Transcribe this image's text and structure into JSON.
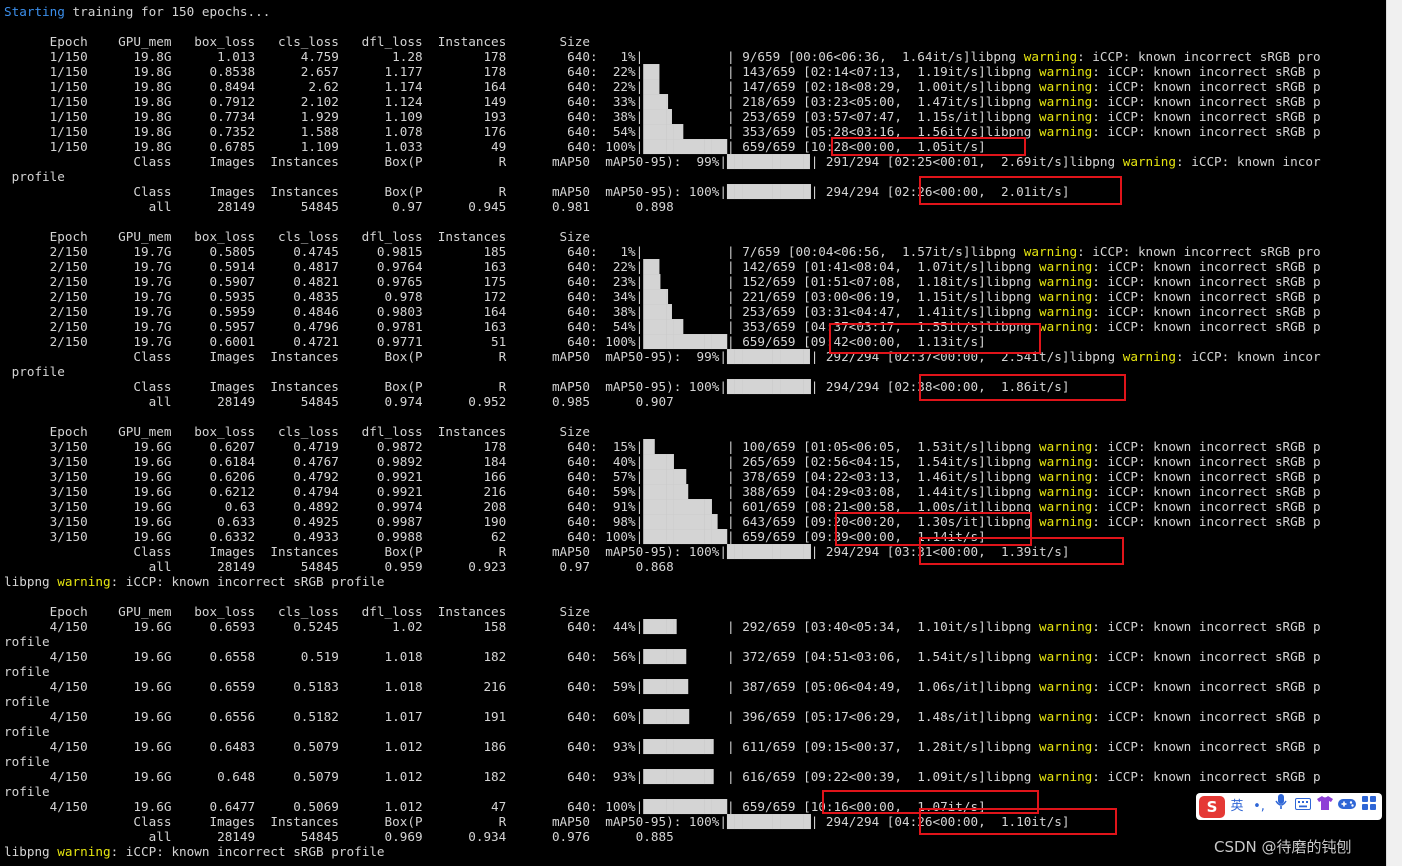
{
  "colors": {
    "background": "#000000",
    "text": "#d4d4d4",
    "info_blue": "#3b8eea",
    "warning_yellow": "#e5e510",
    "highlight_red": "#e0141a"
  },
  "lines": [
    [
      [
        "Starting",
        "b"
      ],
      [
        " training for 150 epochs...",
        "w"
      ]
    ],
    [],
    [
      [
        "      Epoch    GPU_mem   box_loss   cls_loss   dfl_loss  Instances       Size",
        "w"
      ]
    ],
    [
      [
        "      1/150      19.8G      1.013      4.759       1.28        178        640:   1%|           | 9/659 [00:06<06:36,  1.64it/s]libpng ",
        "w"
      ],
      [
        "warning",
        "y"
      ],
      [
        ": iCCP: known incorrect sRGB pro",
        "w"
      ]
    ],
    [
      [
        "      1/150      19.8G     0.8538      2.657      1.177        178        640:  22%|██▏        | 143/659 [02:14<07:13,  1.19it/s]libpng ",
        "w"
      ],
      [
        "warning",
        "y"
      ],
      [
        ": iCCP: known incorrect sRGB p",
        "w"
      ]
    ],
    [
      [
        "      1/150      19.8G     0.8494       2.62      1.174        164        640:  22%|██▏        | 147/659 [02:18<08:29,  1.00it/s]libpng ",
        "w"
      ],
      [
        "warning",
        "y"
      ],
      [
        ": iCCP: known incorrect sRGB p",
        "w"
      ]
    ],
    [
      [
        "      1/150      19.8G     0.7912      2.102      1.124        149        640:  33%|███▎       | 218/659 [03:23<05:00,  1.47it/s]libpng ",
        "w"
      ],
      [
        "warning",
        "y"
      ],
      [
        ": iCCP: known incorrect sRGB p",
        "w"
      ]
    ],
    [
      [
        "      1/150      19.8G     0.7734      1.929      1.109        193        640:  38%|███▊       | 253/659 [03:57<07:47,  1.15s/it]libpng ",
        "w"
      ],
      [
        "warning",
        "y"
      ],
      [
        ": iCCP: known incorrect sRGB p",
        "w"
      ]
    ],
    [
      [
        "      1/150      19.8G     0.7352      1.588      1.078        176        640:  54%|█████▎     | 353/659 [05:28<03:16,  1.56it/s]libpng ",
        "w"
      ],
      [
        "warning",
        "y"
      ],
      [
        ": iCCP: known incorrect sRGB p",
        "w"
      ]
    ],
    [
      [
        "      1/150      19.8G     0.6785      1.109      1.033         49        640: 100%|███████████| 659/659 [10:28<00:00,  1.05it/s]",
        "w"
      ]
    ],
    [
      [
        "                 Class     Images  Instances      Box(P          R      mAP50  mAP50-95):  99%|██████████▉| 291/294 [02:25<00:01,  2.69it/s]libpng ",
        "w"
      ],
      [
        "warning",
        "y"
      ],
      [
        ": iCCP: known incor",
        "w"
      ]
    ],
    [
      [
        " profile",
        "w"
      ]
    ],
    [
      [
        "                 Class     Images  Instances      Box(P          R      mAP50  mAP50-95): 100%|███████████| 294/294 [02:26<00:00,  2.01it/s]",
        "w"
      ]
    ],
    [
      [
        "                   all      28149      54845       0.97      0.945      0.981      0.898",
        "w"
      ]
    ],
    [],
    [
      [
        "      Epoch    GPU_mem   box_loss   cls_loss   dfl_loss  Instances       Size",
        "w"
      ]
    ],
    [
      [
        "      2/150      19.7G     0.5805     0.4745     0.9815        185        640:   1%|           | 7/659 [00:04<06:56,  1.57it/s]libpng ",
        "w"
      ],
      [
        "warning",
        "y"
      ],
      [
        ": iCCP: known incorrect sRGB pro",
        "w"
      ]
    ],
    [
      [
        "      2/150      19.7G     0.5914     0.4817     0.9764        163        640:  22%|██▏        | 142/659 [01:41<08:04,  1.07it/s]libpng ",
        "w"
      ],
      [
        "warning",
        "y"
      ],
      [
        ": iCCP: known incorrect sRGB p",
        "w"
      ]
    ],
    [
      [
        "      2/150      19.7G     0.5907     0.4821     0.9765        175        640:  23%|██▎        | 152/659 [01:51<07:08,  1.18it/s]libpng ",
        "w"
      ],
      [
        "warning",
        "y"
      ],
      [
        ": iCCP: known incorrect sRGB p",
        "w"
      ]
    ],
    [
      [
        "      2/150      19.7G     0.5935     0.4835      0.978        172        640:  34%|███▎       | 221/659 [03:00<06:19,  1.15it/s]libpng ",
        "w"
      ],
      [
        "warning",
        "y"
      ],
      [
        ": iCCP: known incorrect sRGB p",
        "w"
      ]
    ],
    [
      [
        "      2/150      19.7G     0.5959     0.4846     0.9803        164        640:  38%|███▊       | 253/659 [03:31<04:47,  1.41it/s]libpng ",
        "w"
      ],
      [
        "warning",
        "y"
      ],
      [
        ": iCCP: known incorrect sRGB p",
        "w"
      ]
    ],
    [
      [
        "      2/150      19.7G     0.5957     0.4796     0.9781        163        640:  54%|█████▎     | 353/659 [04:37<03:17,  1.55it/s]libpng ",
        "w"
      ],
      [
        "warning",
        "y"
      ],
      [
        ": iCCP: known incorrect sRGB p",
        "w"
      ]
    ],
    [
      [
        "      2/150      19.7G     0.6001     0.4721     0.9771         51        640: 100%|███████████| 659/659 [09:42<00:00,  1.13it/s]",
        "w"
      ]
    ],
    [
      [
        "                 Class     Images  Instances      Box(P          R      mAP50  mAP50-95):  99%|██████████▉| 292/294 [02:37<00:00,  2.54it/s]libpng ",
        "w"
      ],
      [
        "warning",
        "y"
      ],
      [
        ": iCCP: known incor",
        "w"
      ]
    ],
    [
      [
        " profile",
        "w"
      ]
    ],
    [
      [
        "                 Class     Images  Instances      Box(P          R      mAP50  mAP50-95): 100%|███████████| 294/294 [02:38<00:00,  1.86it/s]",
        "w"
      ]
    ],
    [
      [
        "                   all      28149      54845      0.974      0.952      0.985      0.907",
        "w"
      ]
    ],
    [],
    [
      [
        "      Epoch    GPU_mem   box_loss   cls_loss   dfl_loss  Instances       Size",
        "w"
      ]
    ],
    [
      [
        "      3/150      19.6G     0.6207     0.4719     0.9872        178        640:  15%|█▌         | 100/659 [01:05<06:05,  1.53it/s]libpng ",
        "w"
      ],
      [
        "warning",
        "y"
      ],
      [
        ": iCCP: known incorrect sRGB p",
        "w"
      ]
    ],
    [
      [
        "      3/150      19.6G     0.6184     0.4767     0.9892        184        640:  40%|████       | 265/659 [02:56<04:15,  1.54it/s]libpng ",
        "w"
      ],
      [
        "warning",
        "y"
      ],
      [
        ": iCCP: known incorrect sRGB p",
        "w"
      ]
    ],
    [
      [
        "      3/150      19.6G     0.6206     0.4792     0.9921        166        640:  57%|█████▋     | 378/659 [04:22<03:13,  1.46it/s]libpng ",
        "w"
      ],
      [
        "warning",
        "y"
      ],
      [
        ": iCCP: known incorrect sRGB p",
        "w"
      ]
    ],
    [
      [
        "      3/150      19.6G     0.6212     0.4794     0.9921        216        640:  59%|█████▉     | 388/659 [04:29<03:08,  1.44it/s]libpng ",
        "w"
      ],
      [
        "warning",
        "y"
      ],
      [
        ": iCCP: known incorrect sRGB p",
        "w"
      ]
    ],
    [
      [
        "      3/150      19.6G       0.63     0.4892     0.9974        208        640:  91%|█████████  | 601/659 [08:21<00:58,  1.00s/it]libpng ",
        "w"
      ],
      [
        "warning",
        "y"
      ],
      [
        ": iCCP: known incorrect sRGB p",
        "w"
      ]
    ],
    [
      [
        "      3/150      19.6G      0.633     0.4925     0.9987        190        640:  98%|█████████▊ | 643/659 [09:20<00:20,  1.30s/it]libpng ",
        "w"
      ],
      [
        "warning",
        "y"
      ],
      [
        ": iCCP: known incorrect sRGB p",
        "w"
      ]
    ],
    [
      [
        "      3/150      19.6G     0.6332     0.4933     0.9988         62        640: 100%|███████████| 659/659 [09:39<00:00,  1.14it/s]",
        "w"
      ]
    ],
    [
      [
        "                 Class     Images  Instances      Box(P          R      mAP50  mAP50-95): 100%|███████████| 294/294 [03:31<00:00,  1.39it/s]",
        "w"
      ]
    ],
    [
      [
        "                   all      28149      54845      0.959      0.923       0.97      0.868",
        "w"
      ]
    ],
    [
      [
        "libpng ",
        "w"
      ],
      [
        "warning",
        "y"
      ],
      [
        ": iCCP: known incorrect sRGB profile",
        "w"
      ]
    ],
    [],
    [
      [
        "      Epoch    GPU_mem   box_loss   cls_loss   dfl_loss  Instances       Size",
        "w"
      ]
    ],
    [
      [
        "      4/150      19.6G     0.6593     0.5245       1.02        158        640:  44%|████▍      | 292/659 [03:40<05:34,  1.10it/s]libpng ",
        "w"
      ],
      [
        "warning",
        "y"
      ],
      [
        ": iCCP: known incorrect sRGB p",
        "w"
      ]
    ],
    [
      [
        "rofile",
        "w"
      ]
    ],
    [
      [
        "      4/150      19.6G     0.6558      0.519      1.018        182        640:  56%|█████▋     | 372/659 [04:51<03:06,  1.54it/s]libpng ",
        "w"
      ],
      [
        "warning",
        "y"
      ],
      [
        ": iCCP: known incorrect sRGB p",
        "w"
      ]
    ],
    [
      [
        "rofile",
        "w"
      ]
    ],
    [
      [
        "      4/150      19.6G     0.6559     0.5183      1.018        216        640:  59%|█████▉     | 387/659 [05:06<04:49,  1.06s/it]libpng ",
        "w"
      ],
      [
        "warning",
        "y"
      ],
      [
        ": iCCP: known incorrect sRGB p",
        "w"
      ]
    ],
    [
      [
        "rofile",
        "w"
      ]
    ],
    [
      [
        "      4/150      19.6G     0.6556     0.5182      1.017        191        640:  60%|██████     | 396/659 [05:17<06:29,  1.48s/it]libpng ",
        "w"
      ],
      [
        "warning",
        "y"
      ],
      [
        ": iCCP: known incorrect sRGB p",
        "w"
      ]
    ],
    [
      [
        "rofile",
        "w"
      ]
    ],
    [
      [
        "      4/150      19.6G     0.6483     0.5079      1.012        186        640:  93%|█████████▎ | 611/659 [09:15<00:37,  1.28it/s]libpng ",
        "w"
      ],
      [
        "warning",
        "y"
      ],
      [
        ": iCCP: known incorrect sRGB p",
        "w"
      ]
    ],
    [
      [
        "rofile",
        "w"
      ]
    ],
    [
      [
        "      4/150      19.6G      0.648     0.5079      1.012        182        640:  93%|█████████▎ | 616/659 [09:22<00:39,  1.09it/s]libpng ",
        "w"
      ],
      [
        "warning",
        "y"
      ],
      [
        ": iCCP: known incorrect sRGB p",
        "w"
      ]
    ],
    [
      [
        "rofile",
        "w"
      ]
    ],
    [
      [
        "      4/150      19.6G     0.6477     0.5069      1.012         47        640: 100%|███████████| 659/659 [10:16<00:00,  1.07it/s]",
        "w"
      ]
    ],
    [
      [
        "                 Class     Images  Instances      Box(P          R      mAP50  mAP50-95): 100%|███████████| 294/294 [04:26<00:00,  1.10it/s]",
        "w"
      ]
    ],
    [
      [
        "                   all      28149      54845      0.969      0.934      0.976      0.885",
        "w"
      ]
    ],
    [
      [
        "libpng ",
        "w"
      ],
      [
        "warning",
        "y"
      ],
      [
        ": iCCP: known incorrect sRGB profile",
        "w"
      ]
    ]
  ],
  "ime_toolbar": {
    "logo": "S",
    "lang": "英",
    "punct": "•,",
    "mic_icon": "microphone-icon",
    "keyboard_icon": "keyboard-icon",
    "skin_icon": "shirt-icon",
    "game_icon": "gamepad-icon",
    "apps_icon": "grid-icon"
  },
  "watermark": "CSDN @待磨的钝刨"
}
